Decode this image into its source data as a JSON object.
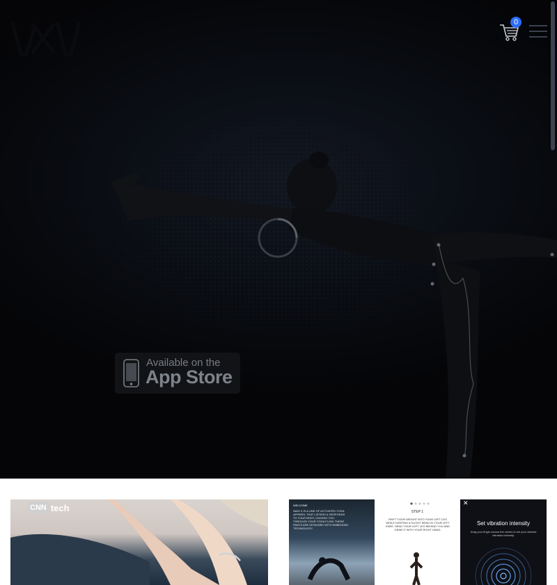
{
  "header": {
    "cart_count": "0",
    "cart_icon": "cart-icon",
    "menu_icon": "hamburger-menu-icon"
  },
  "hero": {
    "appstore_line1": "Available on the",
    "appstore_line2": "App Store"
  },
  "cards": [
    {
      "cnn_box": "CNN",
      "cnn_tech": "tech"
    },
    {
      "welcome": "WELCOME",
      "welcome_body": "NADI X IS A LINE OF ACTIVATED YOGA APPAREL THAT LISTENS & RESPONDS TO YOUR BODY, GUIDING YOU THROUGH YOUR YOGA FLOW. THESE PANTS ARE DESIGNED WITH EMBEDDED TECHNOLOGY.",
      "step": "STEP 1",
      "step_body": "SHIFT YOUR WEIGHT INTO YOUR LEFT LEG WHILE KEEPING A SLIGHT BEND IN YOUR LEFT KNEE. SEND YOUR LEFT LEG BEHIND YOU AND GRAB IT WITH YOUR RIGHT HAND.",
      "vibration_title": "Set vibration intensity",
      "vibration_body": "Drag your finger across the circles to set your desired vibration intensity."
    }
  ]
}
